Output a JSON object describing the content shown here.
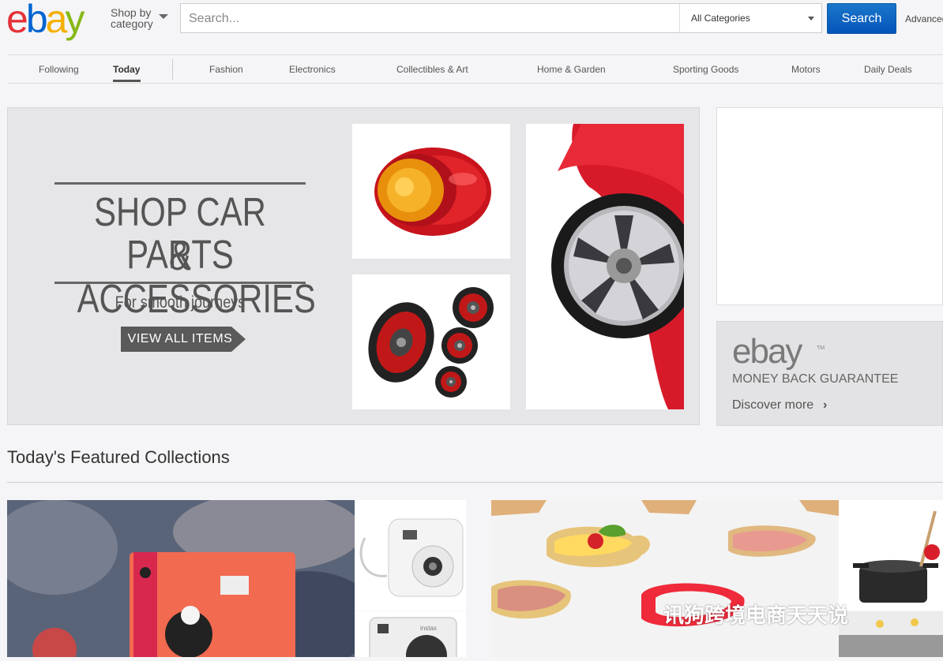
{
  "header": {
    "logo": [
      "e",
      "b",
      "a",
      "y"
    ],
    "shop_by_line1": "Shop by",
    "shop_by_line2": "category",
    "search_placeholder": "Search...",
    "category_select": "All Categories",
    "search_button": "Search",
    "advanced_link": "Advanced"
  },
  "nav": {
    "items": [
      "Following",
      "Today",
      "Fashion",
      "Electronics",
      "Collectibles & Art",
      "Home & Garden",
      "Sporting Goods",
      "Motors",
      "Daily Deals"
    ]
  },
  "hero": {
    "title_line1": "SHOP CAR PARTS",
    "title_line2": "& ACCESSORIES",
    "subtitle": "For smooth journeys",
    "cta": "VIEW ALL ITEMS"
  },
  "guarantee": {
    "logo": "ebay",
    "tm": "TM",
    "title": "MONEY BACK GUARANTEE",
    "link": "Discover more"
  },
  "featured": {
    "title": "Today's Featured Collections"
  },
  "watermark": "讯狗跨境电商天天说",
  "colors": {
    "logo_e": "#e53238",
    "logo_b": "#0064d2",
    "logo_a": "#f5af02",
    "logo_y": "#86b817",
    "search_button": "#0654ba"
  }
}
